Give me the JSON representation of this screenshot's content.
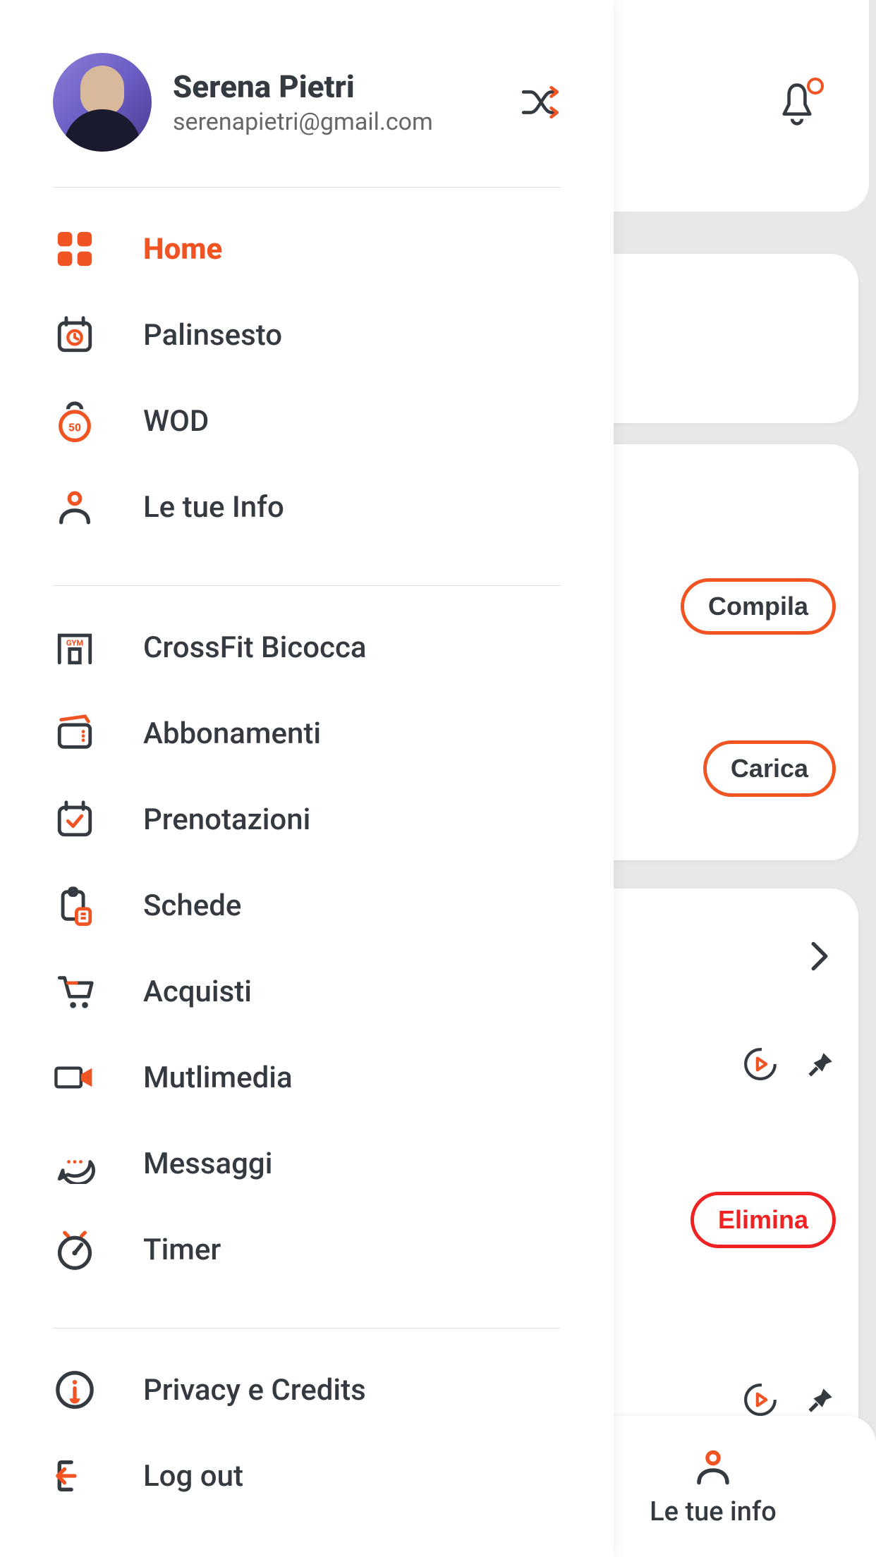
{
  "profile": {
    "name": "Serena Pietri",
    "email": "serenapietri@gmail.com"
  },
  "menu": {
    "group1": [
      {
        "label": "Home",
        "icon": "grid-icon",
        "active": true
      },
      {
        "label": "Palinsesto",
        "icon": "calendar-clock-icon",
        "active": false
      },
      {
        "label": "WOD",
        "icon": "kettlebell-icon",
        "active": false
      },
      {
        "label": "Le tue Info",
        "icon": "person-icon",
        "active": false
      }
    ],
    "group2": [
      {
        "label": "CrossFit Bicocca",
        "icon": "gym-icon",
        "active": false
      },
      {
        "label": "Abbonamenti",
        "icon": "wallet-icon",
        "active": false
      },
      {
        "label": "Prenotazioni",
        "icon": "calendar-check-icon",
        "active": false
      },
      {
        "label": "Schede",
        "icon": "clipboard-icon",
        "active": false
      },
      {
        "label": "Acquisti",
        "icon": "cart-icon",
        "active": false
      },
      {
        "label": "Mutlimedia",
        "icon": "camera-icon",
        "active": false
      },
      {
        "label": "Messaggi",
        "icon": "chat-icon",
        "active": false
      },
      {
        "label": "Timer",
        "icon": "stopwatch-icon",
        "active": false
      }
    ],
    "group3": [
      {
        "label": "Privacy e Credits",
        "icon": "info-icon",
        "active": false
      },
      {
        "label": "Log out",
        "icon": "logout-icon",
        "active": false
      }
    ]
  },
  "content": {
    "buttons": {
      "compila": "Compila",
      "carica": "Carica",
      "elimina": "Elimina"
    },
    "bottom_nav_label": "Le tue info"
  },
  "colors": {
    "accent": "#f05423",
    "text": "#343a40",
    "danger": "#ef2323"
  }
}
